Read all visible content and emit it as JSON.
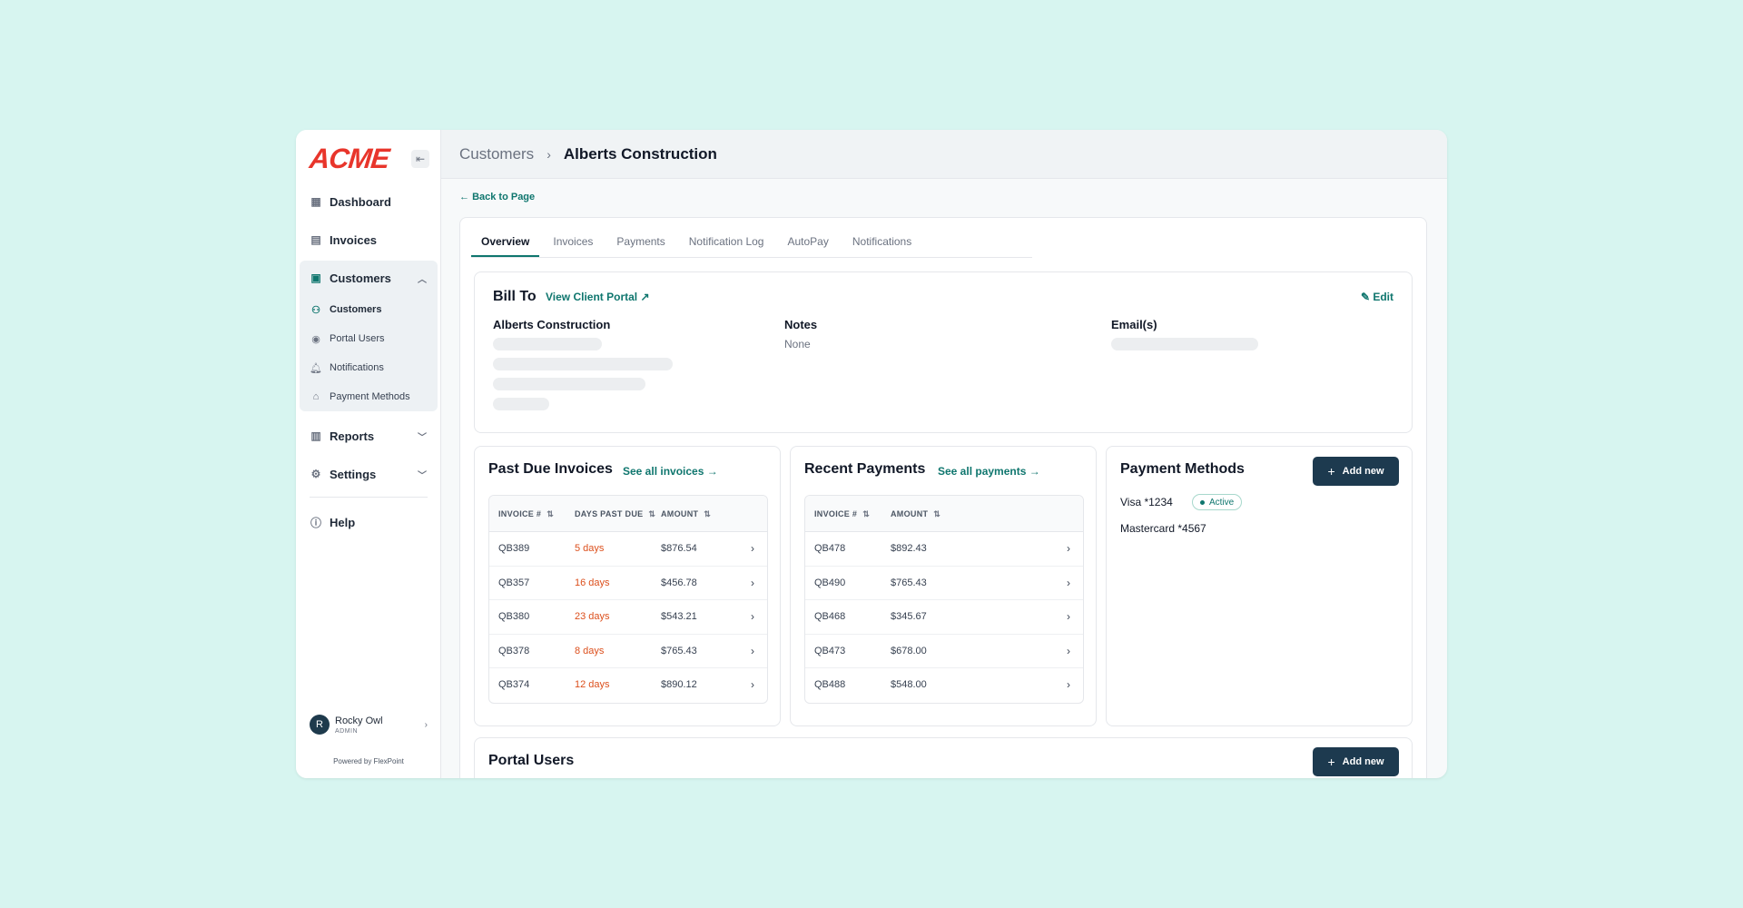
{
  "sidebar": {
    "logo": "ACME",
    "items": [
      {
        "label": "Dashboard",
        "icon": "grid-icon"
      },
      {
        "label": "Invoices",
        "icon": "document-icon"
      },
      {
        "label": "Customers",
        "icon": "briefcase-icon"
      },
      {
        "label": "Reports",
        "icon": "chart-icon"
      },
      {
        "label": "Settings",
        "icon": "gear-icon"
      },
      {
        "label": "Help",
        "icon": "help-icon"
      }
    ],
    "sub_items": [
      {
        "label": "Customers",
        "icon": "users-icon"
      },
      {
        "label": "Portal Users",
        "icon": "user-circle-icon"
      },
      {
        "label": "Notifications",
        "icon": "bell-icon"
      },
      {
        "label": "Payment Methods",
        "icon": "bank-icon"
      }
    ],
    "user": {
      "initial": "R",
      "name": "Rocky Owl",
      "role": "ADMIN"
    },
    "powered_by": "Powered by FlexPoint"
  },
  "header": {
    "crumb_parent": "Customers",
    "crumb_current": "Alberts Construction"
  },
  "back_label": "Back to Page",
  "tabs": [
    "Overview",
    "Invoices",
    "Payments",
    "Notification Log",
    "AutoPay",
    "Notifications"
  ],
  "bill_to": {
    "title": "Bill To",
    "portal_link": "View Client Portal",
    "edit": "Edit",
    "company": "Alberts Construction",
    "notes_label": "Notes",
    "notes_value": "None",
    "emails_label": "Email(s)"
  },
  "past_due": {
    "title": "Past Due Invoices",
    "see_all": "See all invoices",
    "headers": [
      "INVOICE #",
      "DAYS PAST DUE",
      "AMOUNT"
    ],
    "rows": [
      {
        "invoice": "QB389",
        "days": "5 days",
        "amount": "$876.54"
      },
      {
        "invoice": "QB357",
        "days": "16 days",
        "amount": "$456.78"
      },
      {
        "invoice": "QB380",
        "days": "23 days",
        "amount": "$543.21"
      },
      {
        "invoice": "QB378",
        "days": "8 days",
        "amount": "$765.43"
      },
      {
        "invoice": "QB374",
        "days": "12 days",
        "amount": "$890.12"
      }
    ]
  },
  "recent_payments": {
    "title": "Recent Payments",
    "see_all": "See all payments",
    "headers": [
      "INVOICE #",
      "AMOUNT"
    ],
    "rows": [
      {
        "invoice": "QB478",
        "amount": "$892.43"
      },
      {
        "invoice": "QB490",
        "amount": "$765.43"
      },
      {
        "invoice": "QB468",
        "amount": "$345.67"
      },
      {
        "invoice": "QB473",
        "amount": "$678.00"
      },
      {
        "invoice": "QB488",
        "amount": "$548.00"
      }
    ]
  },
  "payment_methods": {
    "title": "Payment Methods",
    "add_label": "Add new",
    "methods": [
      {
        "label": "Visa *1234",
        "badge": "Active"
      },
      {
        "label": "Mastercard *4567"
      }
    ]
  },
  "portal_users": {
    "title": "Portal Users",
    "add_label": "Add new"
  },
  "colors": {
    "accent": "#0f766e",
    "brand": "#e8352b",
    "button": "#1d3a4f",
    "overdue": "#dc4f1c",
    "background": "#d7f5f0"
  }
}
